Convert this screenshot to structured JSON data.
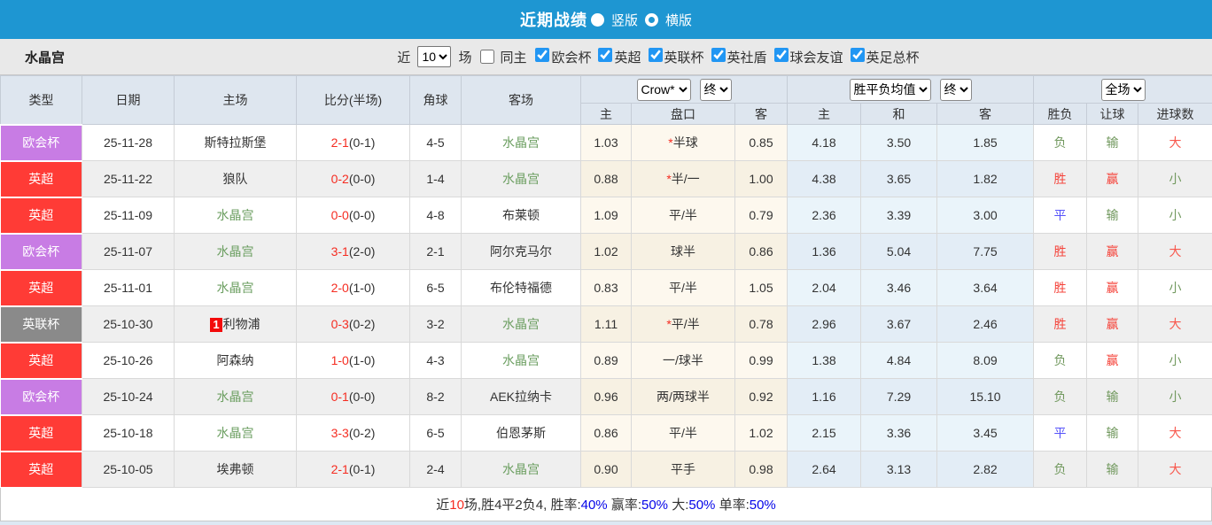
{
  "title_bar": {
    "title": "近期战绩",
    "vertical_label": "竖版",
    "horizontal_label": "横版"
  },
  "filter_bar": {
    "team": "水晶宫",
    "near_label": "近",
    "matches_value": "10",
    "matches_label": "场",
    "same_home_label": "同主",
    "leagues": [
      "欧会杯",
      "英超",
      "英联杯",
      "英社盾",
      "球会友谊",
      "英足总杯"
    ]
  },
  "table": {
    "headers": {
      "type": "类型",
      "date": "日期",
      "home": "主场",
      "score": "比分(半场)",
      "corner": "角球",
      "away": "客场",
      "ah_company": "Crow*",
      "ah_state": "终",
      "ah_home": "主",
      "ah_handicap": "盘口",
      "ah_away": "客",
      "eu_company": "胜平负均值",
      "eu_state": "终",
      "eu_home": "主",
      "eu_draw": "和",
      "eu_away": "客",
      "scope": "全场",
      "res_result": "胜负",
      "res_handicap": "让球",
      "res_goals": "进球数"
    },
    "rows": [
      {
        "type": "欧会杯",
        "date": "25-11-28",
        "home": "斯特拉斯堡",
        "home_rank": "",
        "home_is_team": false,
        "score": "2-1",
        "half": "(0-1)",
        "corner": "4-5",
        "away": "水晶宫",
        "away_is_team": true,
        "ah_home": "1.03",
        "handicap_star": true,
        "handicap": "半球",
        "ah_away": "0.85",
        "odds_home": "4.18",
        "odds_draw": "3.50",
        "odds_away": "1.85",
        "res": "负",
        "res_handicap": "输",
        "res_goals": "大"
      },
      {
        "type": "英超",
        "date": "25-11-22",
        "home": "狼队",
        "home_rank": "",
        "home_is_team": false,
        "score": "0-2",
        "half": "(0-0)",
        "corner": "1-4",
        "away": "水晶宫",
        "away_is_team": true,
        "ah_home": "0.88",
        "handicap_star": true,
        "handicap": "半/一",
        "ah_away": "1.00",
        "odds_home": "4.38",
        "odds_draw": "3.65",
        "odds_away": "1.82",
        "res": "胜",
        "res_handicap": "赢",
        "res_goals": "小"
      },
      {
        "type": "英超",
        "date": "25-11-09",
        "home": "水晶宫",
        "home_rank": "",
        "home_is_team": true,
        "score": "0-0",
        "half": "(0-0)",
        "corner": "4-8",
        "away": "布莱顿",
        "away_is_team": false,
        "ah_home": "1.09",
        "handicap_star": false,
        "handicap": "平/半",
        "ah_away": "0.79",
        "odds_home": "2.36",
        "odds_draw": "3.39",
        "odds_away": "3.00",
        "res": "平",
        "res_handicap": "输",
        "res_goals": "小"
      },
      {
        "type": "欧会杯",
        "date": "25-11-07",
        "home": "水晶宫",
        "home_rank": "",
        "home_is_team": true,
        "score": "3-1",
        "half": "(2-0)",
        "corner": "2-1",
        "away": "阿尔克马尔",
        "away_is_team": false,
        "ah_home": "1.02",
        "handicap_star": false,
        "handicap": "球半",
        "ah_away": "0.86",
        "odds_home": "1.36",
        "odds_draw": "5.04",
        "odds_away": "7.75",
        "res": "胜",
        "res_handicap": "赢",
        "res_goals": "大"
      },
      {
        "type": "英超",
        "date": "25-11-01",
        "home": "水晶宫",
        "home_rank": "",
        "home_is_team": true,
        "score": "2-0",
        "half": "(1-0)",
        "corner": "6-5",
        "away": "布伦特福德",
        "away_is_team": false,
        "ah_home": "0.83",
        "handicap_star": false,
        "handicap": "平/半",
        "ah_away": "1.05",
        "odds_home": "2.04",
        "odds_draw": "3.46",
        "odds_away": "3.64",
        "res": "胜",
        "res_handicap": "赢",
        "res_goals": "小"
      },
      {
        "type": "英联杯",
        "date": "25-10-30",
        "home": "利物浦",
        "home_rank": "1",
        "home_is_team": false,
        "score": "0-3",
        "half": "(0-2)",
        "corner": "3-2",
        "away": "水晶宫",
        "away_is_team": true,
        "ah_home": "1.11",
        "handicap_star": true,
        "handicap": "平/半",
        "ah_away": "0.78",
        "odds_home": "2.96",
        "odds_draw": "3.67",
        "odds_away": "2.46",
        "res": "胜",
        "res_handicap": "赢",
        "res_goals": "大"
      },
      {
        "type": "英超",
        "date": "25-10-26",
        "home": "阿森纳",
        "home_rank": "",
        "home_is_team": false,
        "score": "1-0",
        "half": "(1-0)",
        "corner": "4-3",
        "away": "水晶宫",
        "away_is_team": true,
        "ah_home": "0.89",
        "handicap_star": false,
        "handicap": "一/球半",
        "ah_away": "0.99",
        "odds_home": "1.38",
        "odds_draw": "4.84",
        "odds_away": "8.09",
        "res": "负",
        "res_handicap": "赢",
        "res_goals": "小"
      },
      {
        "type": "欧会杯",
        "date": "25-10-24",
        "home": "水晶宫",
        "home_rank": "",
        "home_is_team": true,
        "score": "0-1",
        "half": "(0-0)",
        "corner": "8-2",
        "away": "AEK拉纳卡",
        "away_is_team": false,
        "ah_home": "0.96",
        "handicap_star": false,
        "handicap": "两/两球半",
        "ah_away": "0.92",
        "odds_home": "1.16",
        "odds_draw": "7.29",
        "odds_away": "15.10",
        "res": "负",
        "res_handicap": "输",
        "res_goals": "小"
      },
      {
        "type": "英超",
        "date": "25-10-18",
        "home": "水晶宫",
        "home_rank": "",
        "home_is_team": true,
        "score": "3-3",
        "half": "(0-2)",
        "corner": "6-5",
        "away": "伯恩茅斯",
        "away_is_team": false,
        "ah_home": "0.86",
        "handicap_star": false,
        "handicap": "平/半",
        "ah_away": "1.02",
        "odds_home": "2.15",
        "odds_draw": "3.36",
        "odds_away": "3.45",
        "res": "平",
        "res_handicap": "输",
        "res_goals": "大"
      },
      {
        "type": "英超",
        "date": "25-10-05",
        "home": "埃弗顿",
        "home_rank": "",
        "home_is_team": false,
        "score": "2-1",
        "half": "(0-1)",
        "corner": "2-4",
        "away": "水晶宫",
        "away_is_team": true,
        "ah_home": "0.90",
        "handicap_star": false,
        "handicap": "平手",
        "ah_away": "0.98",
        "odds_home": "2.64",
        "odds_draw": "3.13",
        "odds_away": "2.82",
        "res": "负",
        "res_handicap": "输",
        "res_goals": "大"
      }
    ]
  },
  "footer": {
    "segments": [
      {
        "t": "近",
        "c": "dark"
      },
      {
        "t": "10",
        "c": "red"
      },
      {
        "t": "场,胜4平2负4, 胜率:",
        "c": "dark"
      },
      {
        "t": "40%",
        "c": "blue"
      },
      {
        "t": " 赢率:",
        "c": "dark"
      },
      {
        "t": "50%",
        "c": "blue"
      },
      {
        "t": " 大:",
        "c": "dark"
      },
      {
        "t": "50%",
        "c": "blue"
      },
      {
        "t": " 单率:",
        "c": "dark"
      },
      {
        "t": "50%",
        "c": "blue"
      }
    ]
  },
  "colors": {
    "banner_blue": "#1e96d2",
    "type_colors": {
      "欧会杯": "#c87ce4",
      "英超": "#ff3b36",
      "英联杯": "#8a8a8a"
    },
    "result_color_map": {
      "胜": "#f5443b",
      "平": "#5552fa",
      "负": "#72995f",
      "赢": "#f5443b",
      "输": "#72995f",
      "大": "#f8574c",
      "小": "#72995f"
    },
    "score_red": "#f52c21",
    "team_green": "#6b9e60"
  }
}
